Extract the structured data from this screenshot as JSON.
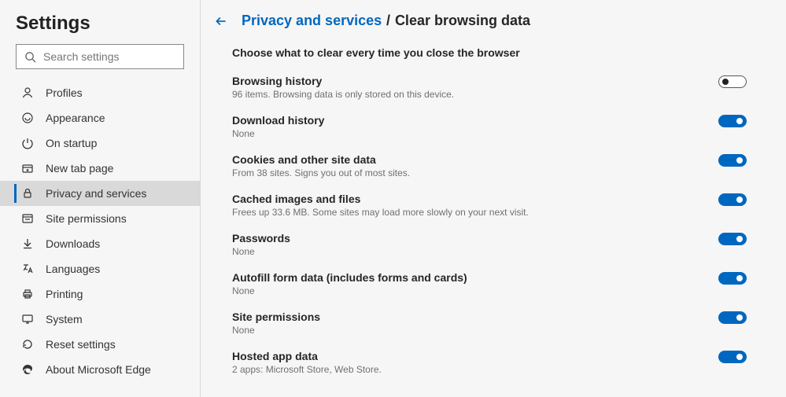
{
  "page_title": "Settings",
  "search": {
    "placeholder": "Search settings"
  },
  "nav": {
    "items": [
      {
        "label": "Profiles",
        "icon": "profile-icon"
      },
      {
        "label": "Appearance",
        "icon": "appearance-icon"
      },
      {
        "label": "On startup",
        "icon": "power-icon"
      },
      {
        "label": "New tab page",
        "icon": "new-tab-icon"
      },
      {
        "label": "Privacy and services",
        "icon": "lock-icon",
        "active": true
      },
      {
        "label": "Site permissions",
        "icon": "permissions-icon"
      },
      {
        "label": "Downloads",
        "icon": "download-icon"
      },
      {
        "label": "Languages",
        "icon": "language-icon"
      },
      {
        "label": "Printing",
        "icon": "printer-icon"
      },
      {
        "label": "System",
        "icon": "system-icon"
      },
      {
        "label": "Reset settings",
        "icon": "reset-icon"
      },
      {
        "label": "About Microsoft Edge",
        "icon": "edge-icon"
      }
    ]
  },
  "breadcrumb": {
    "parent": "Privacy and services",
    "sep": "/",
    "current": "Clear browsing data"
  },
  "section_heading": "Choose what to clear every time you close the browser",
  "options": [
    {
      "title": "Browsing history",
      "desc": "96 items. Browsing data is only stored on this device.",
      "on": false
    },
    {
      "title": "Download history",
      "desc": "None",
      "on": true
    },
    {
      "title": "Cookies and other site data",
      "desc": "From 38 sites. Signs you out of most sites.",
      "on": true
    },
    {
      "title": "Cached images and files",
      "desc": "Frees up 33.6 MB. Some sites may load more slowly on your next visit.",
      "on": true
    },
    {
      "title": "Passwords",
      "desc": "None",
      "on": true
    },
    {
      "title": "Autofill form data (includes forms and cards)",
      "desc": "None",
      "on": true
    },
    {
      "title": "Site permissions",
      "desc": "None",
      "on": true
    },
    {
      "title": "Hosted app data",
      "desc": "2 apps: Microsoft Store, Web Store.",
      "on": true
    }
  ]
}
